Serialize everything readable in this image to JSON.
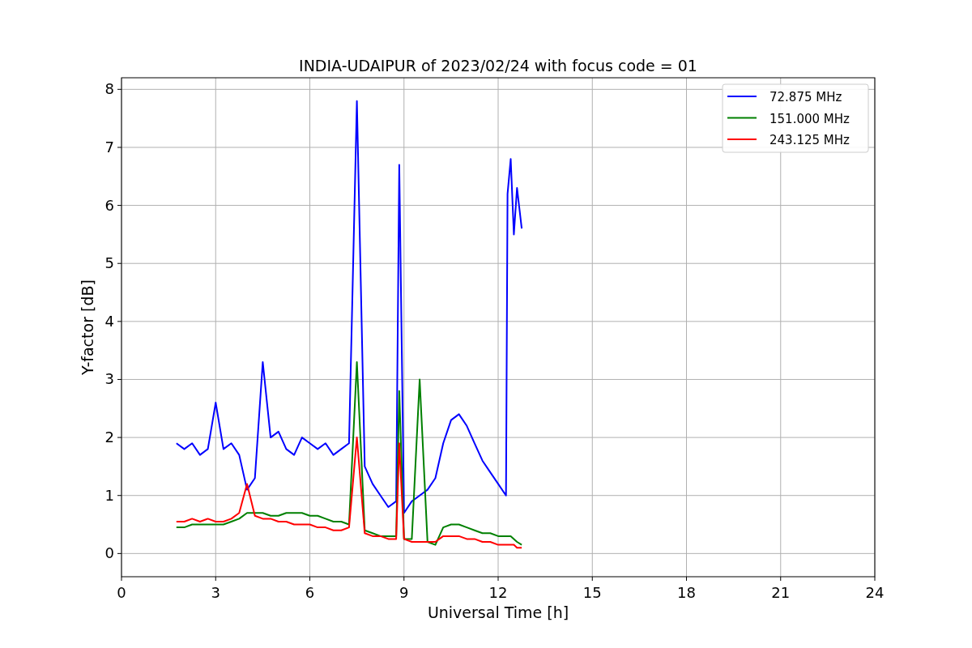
{
  "figure": {
    "chart_data": {
      "type": "line",
      "title": "INDIA-UDAIPUR of 2023/02/24 with focus code = 01",
      "xlabel": "Universal Time [h]",
      "ylabel": "Y-factor [dB]",
      "x": [
        1.75,
        2,
        2.25,
        2.5,
        2.75,
        3,
        3.25,
        3.5,
        3.75,
        4,
        4.25,
        4.5,
        4.75,
        5,
        5.25,
        5.5,
        5.75,
        6,
        6.25,
        6.5,
        6.75,
        7,
        7.25,
        7.5,
        7.75,
        8,
        8.25,
        8.5,
        8.75,
        8.85,
        9,
        9.25,
        9.5,
        9.75,
        10,
        10.25,
        10.5,
        10.75,
        11,
        11.25,
        11.5,
        11.75,
        12,
        12.25,
        12.3,
        12.4,
        12.5,
        12.6,
        12.75
      ],
      "series": [
        {
          "name": "72.875 MHz",
          "color": "#0000ff",
          "values": [
            1.9,
            1.8,
            1.9,
            1.7,
            1.8,
            2.6,
            1.8,
            1.9,
            1.7,
            1.1,
            1.3,
            3.3,
            2.0,
            2.1,
            1.8,
            1.7,
            2.0,
            1.9,
            1.8,
            1.9,
            1.7,
            1.8,
            1.9,
            7.8,
            1.5,
            1.2,
            1.0,
            0.8,
            0.9,
            6.7,
            0.7,
            0.9,
            1.0,
            1.1,
            1.3,
            1.9,
            2.3,
            2.4,
            2.2,
            1.9,
            1.6,
            1.4,
            1.2,
            1.0,
            6.2,
            6.8,
            5.5,
            6.3,
            5.6
          ]
        },
        {
          "name": "151.000 MHz",
          "color": "#008000",
          "values": [
            0.45,
            0.45,
            0.5,
            0.5,
            0.5,
            0.5,
            0.5,
            0.55,
            0.6,
            0.7,
            0.7,
            0.7,
            0.65,
            0.65,
            0.7,
            0.7,
            0.7,
            0.65,
            0.65,
            0.6,
            0.55,
            0.55,
            0.5,
            3.3,
            0.4,
            0.35,
            0.3,
            0.3,
            0.3,
            2.8,
            0.25,
            0.25,
            3.0,
            0.2,
            0.15,
            0.45,
            0.5,
            0.5,
            0.45,
            0.4,
            0.35,
            0.35,
            0.3,
            0.3,
            0.3,
            0.3,
            0.25,
            0.2,
            0.15
          ]
        },
        {
          "name": "243.125 MHz",
          "color": "#ff0000",
          "values": [
            0.55,
            0.55,
            0.6,
            0.55,
            0.6,
            0.55,
            0.55,
            0.6,
            0.7,
            1.2,
            0.65,
            0.6,
            0.6,
            0.55,
            0.55,
            0.5,
            0.5,
            0.5,
            0.45,
            0.45,
            0.4,
            0.4,
            0.45,
            2.0,
            0.35,
            0.3,
            0.3,
            0.25,
            0.25,
            1.9,
            0.25,
            0.2,
            0.2,
            0.2,
            0.2,
            0.3,
            0.3,
            0.3,
            0.25,
            0.25,
            0.2,
            0.2,
            0.15,
            0.15,
            0.15,
            0.15,
            0.15,
            0.1,
            0.1
          ]
        }
      ],
      "xlim": [
        0,
        24
      ],
      "ylim": [
        -0.4,
        8.2
      ],
      "xticks": [
        0,
        3,
        6,
        9,
        12,
        15,
        18,
        21,
        24
      ],
      "yticks": [
        0,
        1,
        2,
        3,
        4,
        5,
        6,
        7,
        8
      ],
      "grid": true,
      "legend": true
    }
  }
}
